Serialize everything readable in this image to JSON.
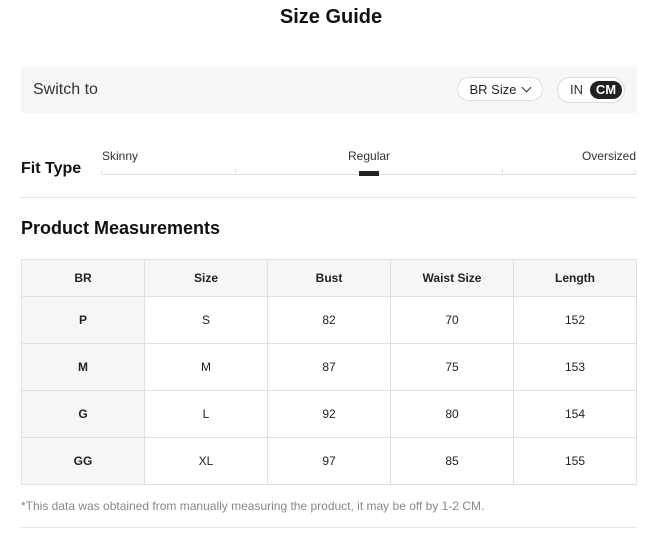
{
  "title": "Size Guide",
  "switch": {
    "label": "Switch to",
    "size_system": "BR Size",
    "units": [
      "IN",
      "CM"
    ],
    "selected_unit": "CM"
  },
  "fit": {
    "label": "Fit Type",
    "options": [
      "Skinny",
      "Regular",
      "Oversized"
    ],
    "selected": "Regular"
  },
  "measurements": {
    "title": "Product Measurements",
    "headers": [
      "BR",
      "Size",
      "Bust",
      "Waist Size",
      "Length"
    ],
    "rows": [
      [
        "P",
        "S",
        "82",
        "70",
        "152"
      ],
      [
        "M",
        "M",
        "87",
        "75",
        "153"
      ],
      [
        "G",
        "L",
        "92",
        "80",
        "154"
      ],
      [
        "GG",
        "XL",
        "97",
        "85",
        "155"
      ]
    ]
  },
  "note": "*This data was obtained from manually measuring the product, it may be off by 1-2 CM.",
  "colors": {
    "accent": "#222222",
    "panel_bg": "#f6f6f6",
    "border": "#e0e0e0",
    "muted_text": "#888888"
  },
  "icons": {
    "size_select": "chevron-down-icon"
  }
}
